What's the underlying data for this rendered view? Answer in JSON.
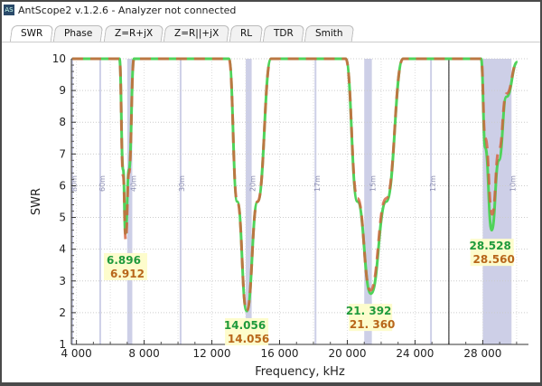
{
  "window": {
    "title": "AntScope2 v.1.2.6 - Analyzer not connected",
    "icon_label": "AS"
  },
  "tabs": [
    {
      "label": "SWR",
      "active": true
    },
    {
      "label": "Phase"
    },
    {
      "label": "Z=R+jX"
    },
    {
      "label": "Z=R||+jX"
    },
    {
      "label": "RL"
    },
    {
      "label": "TDR"
    },
    {
      "label": "Smith"
    }
  ],
  "colors": {
    "green_trace": "#4fd35a",
    "red_trace": "#d4603c",
    "band": "#c8cae4",
    "marker_bg": "#fdfccc",
    "green_text": "#1f9a3c",
    "brown_text": "#b8661a"
  },
  "chart_data": {
    "type": "line",
    "xlabel": "Frequency, kHz",
    "ylabel": "SWR",
    "xlim": [
      3700,
      30700
    ],
    "ylim": [
      1,
      10
    ],
    "xticks": [
      4000,
      8000,
      12000,
      16000,
      20000,
      24000,
      28000
    ],
    "xtick_labels": [
      "4 000",
      "8 000",
      "12 000",
      "16 000",
      "20 000",
      "24 000",
      "28 000"
    ],
    "yticks": [
      1,
      2,
      3,
      4,
      5,
      6,
      7,
      8,
      9,
      10
    ],
    "grid": true,
    "cursor_line_x": 26000,
    "bands": [
      {
        "name": "80m",
        "from": 3700,
        "to": 3800
      },
      {
        "name": "60m",
        "from": 5350,
        "to": 5450
      },
      {
        "name": "40m",
        "from": 7000,
        "to": 7300
      },
      {
        "name": "30m",
        "from": 10100,
        "to": 10150
      },
      {
        "name": "20m",
        "from": 14000,
        "to": 14350
      },
      {
        "name": "17m",
        "from": 18068,
        "to": 18168
      },
      {
        "name": "15m",
        "from": 21000,
        "to": 21450
      },
      {
        "name": "12m",
        "from": 24890,
        "to": 24990
      },
      {
        "name": "10m",
        "from": 28000,
        "to": 29700
      }
    ],
    "series": [
      {
        "color": "#4fd35a",
        "points": [
          [
            3750,
            10
          ],
          [
            6540,
            10
          ],
          [
            6760,
            6.5
          ],
          [
            6896,
            4.5
          ],
          [
            7100,
            6.5
          ],
          [
            7400,
            10
          ],
          [
            13000,
            10
          ],
          [
            13500,
            5.5
          ],
          [
            14056,
            2.05
          ],
          [
            14700,
            5.5
          ],
          [
            15500,
            10
          ],
          [
            19900,
            10
          ],
          [
            20600,
            5.5
          ],
          [
            21392,
            2.6
          ],
          [
            22300,
            5.5
          ],
          [
            23300,
            10
          ],
          [
            27900,
            10
          ],
          [
            28150,
            7.2
          ],
          [
            28528,
            4.6
          ],
          [
            28950,
            6.8
          ],
          [
            29400,
            8.8
          ],
          [
            30050,
            9.9
          ]
        ]
      },
      {
        "color": "#d4603c",
        "points": [
          [
            3750,
            10
          ],
          [
            6540,
            10
          ],
          [
            6760,
            6.3
          ],
          [
            6912,
            4.3
          ],
          [
            7100,
            6.4
          ],
          [
            7400,
            10
          ],
          [
            13000,
            10
          ],
          [
            13500,
            5.5
          ],
          [
            14056,
            2.05
          ],
          [
            14700,
            5.5
          ],
          [
            15500,
            10
          ],
          [
            19900,
            10
          ],
          [
            20600,
            5.6
          ],
          [
            21360,
            2.7
          ],
          [
            22300,
            5.6
          ],
          [
            23300,
            10
          ],
          [
            27900,
            10
          ],
          [
            28150,
            7.5
          ],
          [
            28560,
            5.1
          ],
          [
            28950,
            7.1
          ],
          [
            29400,
            8.9
          ],
          [
            30050,
            9.9
          ]
        ]
      }
    ],
    "markers": [
      {
        "freq_green": "6.896",
        "freq_red": "6.912",
        "x": 6900,
        "y": 3.65
      },
      {
        "freq_green": "14.056",
        "freq_red": "14.056",
        "x": 14056,
        "y": 1.6
      },
      {
        "freq_green": "21. 392",
        "freq_red": "21. 360",
        "x": 21370,
        "y": 2.05
      },
      {
        "freq_green": "28.528",
        "freq_red": "28.560",
        "x": 28550,
        "y": 4.1
      }
    ]
  }
}
